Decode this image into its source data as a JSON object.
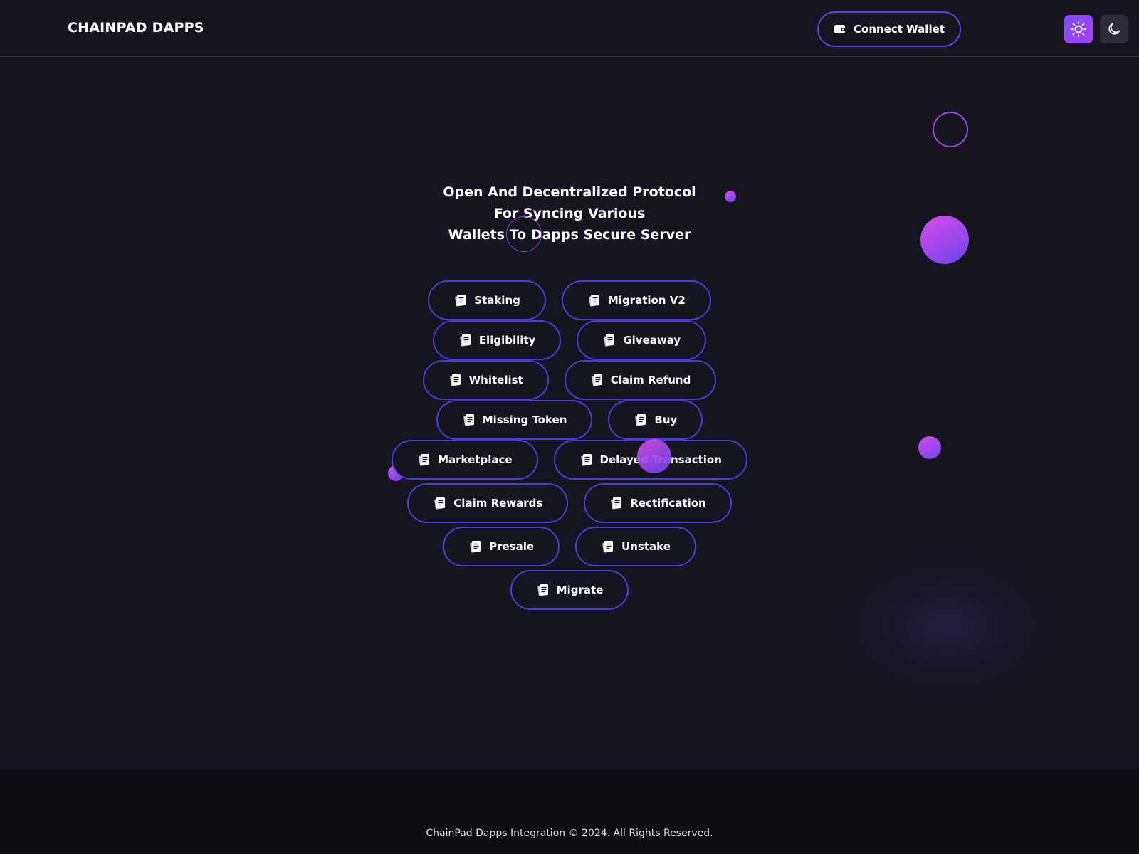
{
  "header": {
    "brand": "CHAINPAD DAPPS",
    "connect_wallet_label": "Connect Wallet"
  },
  "hero": {
    "lines": [
      "Open And Decentralized Protocol",
      "For Syncing Various",
      "Wallets To Dapps Secure Server"
    ]
  },
  "actions": [
    [
      "Staking",
      "Migration V2"
    ],
    [
      "Eligibility",
      "Giveaway"
    ],
    [
      "Whitelist",
      "Claim Refund"
    ],
    [
      "Missing Token",
      "Buy"
    ],
    [
      "Marketplace",
      "Delayed Transaction"
    ],
    [
      "Claim Rewards",
      "Rectification"
    ],
    [
      "Presale",
      "Unstake"
    ],
    [
      "Migrate"
    ]
  ],
  "footer": {
    "text": "ChainPad Dapps Integration © 2024. All Rights Reserved."
  },
  "icons": {
    "wallet": "wallet-icon",
    "sun": "sun-icon",
    "moon": "moon-icon",
    "document": "document-icon"
  },
  "colors": {
    "background": "#15151f",
    "footer_background": "#0d0d12",
    "accent_border": "#4a3cdb",
    "gradient_start": "#d94be8",
    "gradient_end": "#6a45ee"
  }
}
